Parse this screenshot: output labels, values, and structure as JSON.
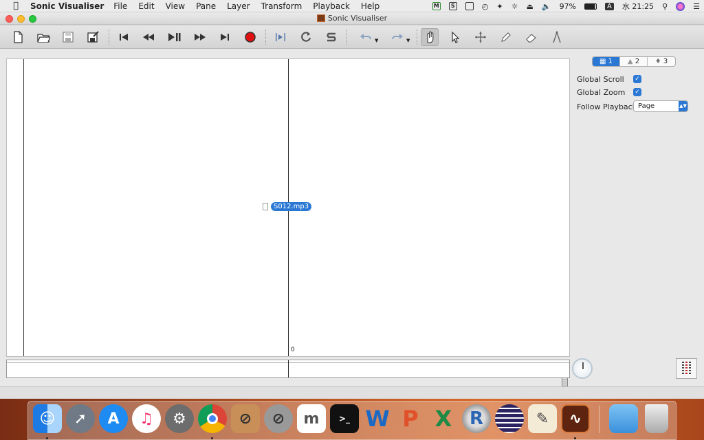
{
  "menubar": {
    "apple": "",
    "app_name": "Sonic Visualiser",
    "menus": [
      "File",
      "Edit",
      "View",
      "Pane",
      "Layer",
      "Transform",
      "Playback",
      "Help"
    ],
    "battery": "97%",
    "input_method": "A",
    "clock": "水 21:25"
  },
  "window": {
    "title": "Sonic Visualiser",
    "controls": [
      "close",
      "minimize",
      "zoom"
    ]
  },
  "toolbar": {
    "buttons": [
      "new-session",
      "open",
      "save",
      "save-as",
      "rewind-start",
      "rewind",
      "play-pause",
      "fast-forward",
      "ffwd-end",
      "record",
      "play-selection",
      "loop",
      "solo",
      "undo",
      "redo",
      "navigate",
      "select",
      "move",
      "draw",
      "erase",
      "measure"
    ],
    "active_tool": "navigate"
  },
  "pane": {
    "ruler_zero": "0",
    "file_label": "S012.mp3"
  },
  "side_panel": {
    "tabs": [
      "1",
      "2",
      "3"
    ],
    "active_tab": "1",
    "global_scroll_label": "Global Scroll",
    "global_scroll_checked": true,
    "global_zoom_label": "Global Zoom",
    "global_zoom_checked": true,
    "follow_playback_label": "Follow Playback",
    "follow_playback_value": "Page"
  },
  "dock": {
    "apps": [
      "Finder",
      "Launchpad",
      "App Store",
      "iTunes",
      "System Preferences",
      "Google Chrome",
      "Instruments",
      "Disk Utility",
      "MuseScore",
      "Terminal",
      "Microsoft Word",
      "Microsoft PowerPoint",
      "Microsoft Excel",
      "R",
      "Eclipse",
      "TextEdit",
      "Sonic Visualiser",
      "Downloads",
      "Trash"
    ]
  },
  "colors": {
    "accent": "#2a78d3",
    "record": "#e01010",
    "dock_bg": "#b3501f"
  }
}
